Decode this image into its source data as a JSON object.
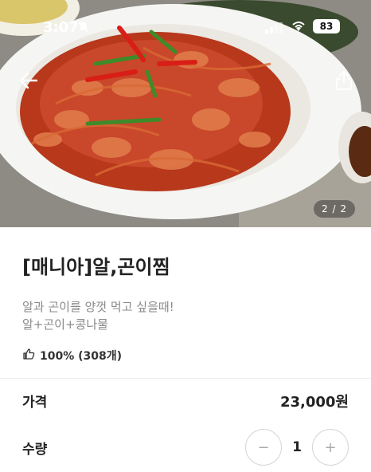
{
  "status_bar": {
    "time": "3:07",
    "battery": "83"
  },
  "gallery": {
    "counter": "2 / 2"
  },
  "product": {
    "title": "[매니아]알,곤이찜",
    "desc_line1": "알과 곤이를 양껏 먹고 싶을때!",
    "desc_line2": "알+곤이+콩나물",
    "rating": "100% (308개)"
  },
  "price": {
    "label": "가격",
    "value": "23,000원"
  },
  "quantity": {
    "label": "수량",
    "value": "1",
    "minus": "−",
    "plus": "+"
  },
  "colors": {
    "sauce": "#c2331d",
    "plate": "#f4f4f2",
    "text_muted": "#8a8a8a"
  },
  "icons": [
    "back-arrow-icon",
    "share-icon",
    "bell-slash-icon",
    "signal-icon",
    "wifi-icon",
    "battery-icon",
    "thumbs-up-icon"
  ]
}
